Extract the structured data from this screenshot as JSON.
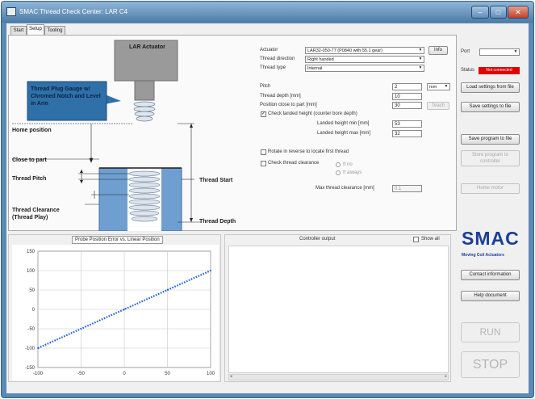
{
  "window": {
    "title": "SMAC Thread Check Center: LAR C4",
    "controls": {
      "minimize": "–",
      "maximize": "□",
      "close": "✕"
    }
  },
  "tabs": [
    {
      "label": "Start"
    },
    {
      "label": "Setup",
      "active": true
    },
    {
      "label": "Tooling"
    }
  ],
  "illustration": {
    "actuator_label": "LAR Actuator",
    "plug_callout": "Thread Plug Gauge w/ Chromed Notch and Level in Arm",
    "home_position": "Home position",
    "close_to_part": "Close to part",
    "thread_pitch": "Thread Pitch",
    "thread_clearance": "Thread Clearance (Thread Play)",
    "thread_start": "Thread Start",
    "thread_depth": "Thread Depth"
  },
  "settings": {
    "actuator": {
      "label": "Actuator",
      "value": "LAR32-050-77 (P0840 with 55.1 gear)",
      "info_button": "Info"
    },
    "thread_direction": {
      "label": "Thread direction",
      "value": "Right handed"
    },
    "thread_type": {
      "label": "Thread type",
      "value": "Internal"
    },
    "pitch": {
      "label": "Pitch",
      "value": "2",
      "unit": "mm"
    },
    "thread_depth": {
      "label": "Thread depth [mm]",
      "value": "10"
    },
    "position_close_to_part": {
      "label": "Position close to part [mm]",
      "value": "30",
      "teach_button": "Teach"
    },
    "check_landed_height": {
      "label": "Check landed height (counter bore depth)",
      "checked": true
    },
    "landed_height_min": {
      "label": "Landed height min [mm]",
      "value": "53"
    },
    "landed_height_max": {
      "label": "Landed height max [mm]",
      "value": "32"
    },
    "rotate_in_reverse": {
      "label": "Rotate in reverse to locate first thread",
      "checked": false
    },
    "check_thread_clearance": {
      "label": "Check thread clearance",
      "checked": false
    },
    "clearance_options": [
      "If no",
      "If always"
    ],
    "max_thread_clearance": {
      "label": "Max thread clearance [mm]",
      "value": "0.1"
    }
  },
  "chart_panel": {
    "title": "Probe Position Error vs. Linear Position"
  },
  "controller_panel": {
    "title": "Controller output",
    "show_all_label": "Show all",
    "show_all_checked": false
  },
  "sidebar": {
    "port_label": "Port",
    "port_value": "",
    "status_label": "Status",
    "status_value": "Not connected",
    "load_settings": "Load settings from file",
    "save_settings": "Save settings to file",
    "save_program": "Save program to file",
    "store_program": "Store program to controller",
    "home_motor": "Home motor",
    "logo_text": "SMAC",
    "logo_tagline": "Moving Coil Actuators",
    "contact": "Contact information",
    "help": "Help document",
    "run": "RUN",
    "stop": "STOP"
  },
  "chart_data": {
    "type": "line",
    "title": "Probe Position Error vs. Linear Position",
    "x_ticks": [
      -100,
      -50,
      0,
      50,
      100
    ],
    "y_ticks": [
      150,
      100,
      50,
      0,
      -50,
      -100,
      -150
    ],
    "xlim": [
      -100,
      100
    ],
    "ylim": [
      -150,
      150
    ],
    "grid": true,
    "series": [
      {
        "color": "#1f5fd6",
        "style": "dotted",
        "x": [
          -100,
          -50,
          0,
          50,
          100
        ],
        "y": [
          -100,
          -50,
          0,
          50,
          100
        ]
      }
    ]
  }
}
